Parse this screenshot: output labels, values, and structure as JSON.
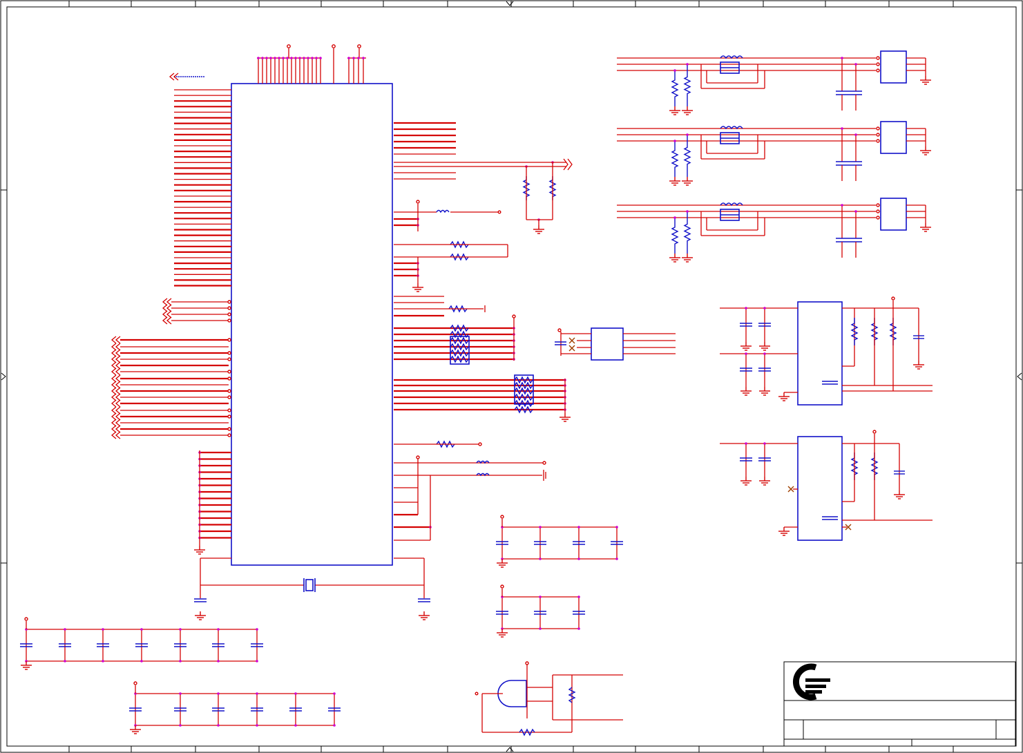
{
  "diagram": {
    "kind": "circuit-schematic",
    "colors": {
      "wire": "#d40000",
      "component": "#1010c8",
      "junction": "#d000d0",
      "frame": "#000000",
      "no_connect": "#a04000"
    },
    "logo": {
      "icon": "company-logo-icon"
    }
  }
}
